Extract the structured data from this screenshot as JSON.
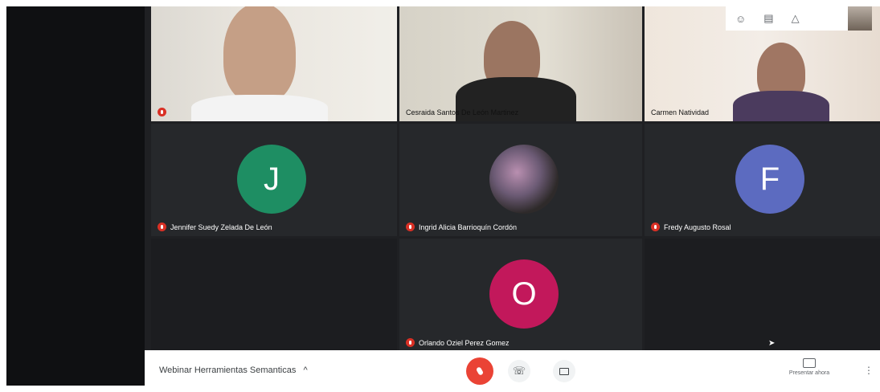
{
  "meeting": {
    "title": "Webinar Herramientas Semanticas",
    "chevron": "^",
    "present_label": "Presentar ahora"
  },
  "participants": [
    {
      "name": "",
      "avatar_letter": "",
      "type": "video",
      "muted": true
    },
    {
      "name": "Cesraida Santos De León Martinez",
      "avatar_letter": "",
      "type": "video",
      "muted": false
    },
    {
      "name": "Carmen Natividad",
      "avatar_letter": "",
      "type": "video",
      "muted": false
    },
    {
      "name": "Jennifer Suedy Zelada De León",
      "avatar_letter": "J",
      "type": "avatar",
      "muted": true,
      "color": "#1e8e63"
    },
    {
      "name": "Ingrid Alicia Barrioquín Cordón",
      "avatar_letter": "",
      "type": "photo",
      "muted": true
    },
    {
      "name": "Fredy Augusto Rosal",
      "avatar_letter": "F",
      "type": "avatar",
      "muted": true,
      "color": "#5c6bc0"
    },
    {
      "name": "Orlando Oziel Perez Gomez",
      "avatar_letter": "O",
      "type": "avatar",
      "muted": true,
      "color": "#c2185b"
    }
  ],
  "icons": {
    "people": "people-icon",
    "chat": "chat-icon",
    "activities": "activities-icon",
    "mic_off": "mic-off-icon",
    "hangup": "hangup-icon",
    "camera": "camera-icon",
    "present": "present-screen-icon",
    "more": "more-icon"
  },
  "colors": {
    "end_call": "#ea4335",
    "muted_badge": "#d93025",
    "tile_bg": "#26282b"
  }
}
